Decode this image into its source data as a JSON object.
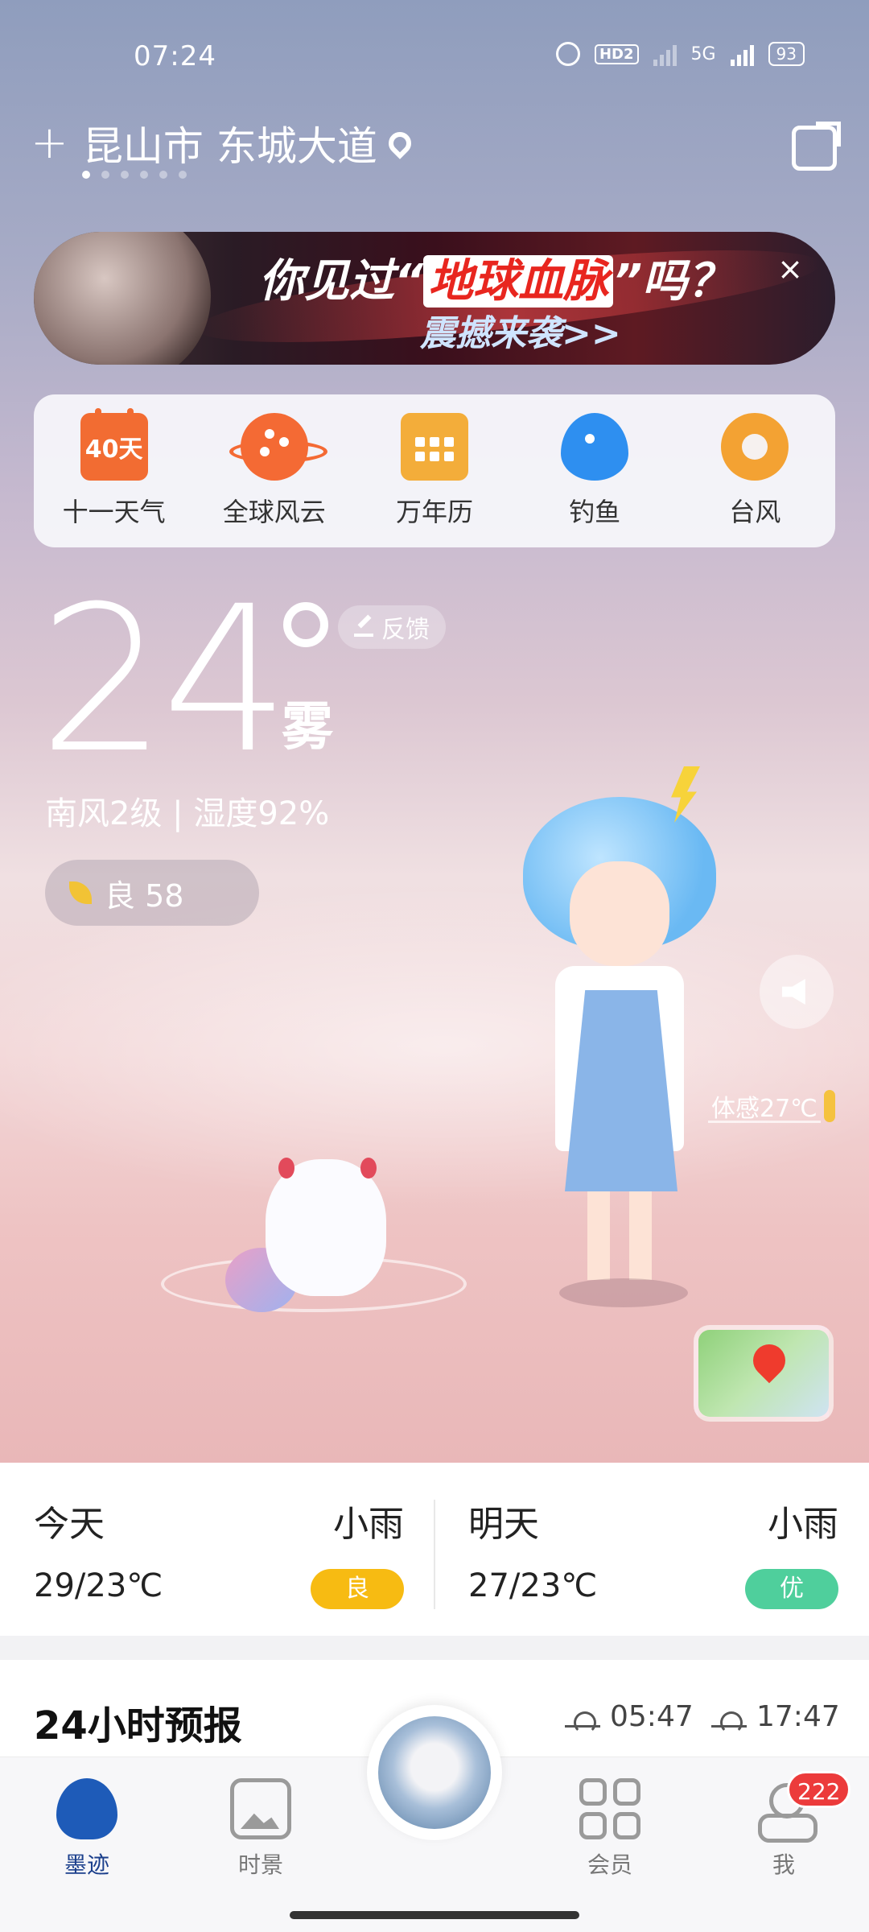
{
  "status_bar": {
    "time": "07:24",
    "hd_label": "HD2",
    "network": "5G",
    "battery": "93"
  },
  "location": {
    "add_symbol": "+",
    "name": "昆山市 东城大道"
  },
  "banner": {
    "prefix": "你见过“",
    "highlight": "地球血脉",
    "suffix": "”吗？",
    "line2": "震撼来袭>>",
    "close_symbol": "×"
  },
  "shortcuts": [
    {
      "label": "十一天气",
      "icon": "calendar-40-icon",
      "icon_text": "40天"
    },
    {
      "label": "全球风云",
      "icon": "globe-planet-icon"
    },
    {
      "label": "万年历",
      "icon": "calendar-grid-icon"
    },
    {
      "label": "钓鱼",
      "icon": "fish-icon"
    },
    {
      "label": "台风",
      "icon": "typhoon-icon"
    }
  ],
  "current": {
    "temperature": "24",
    "condition": "雾",
    "feedback": "反馈",
    "wind_humidity": "南风2级 | 湿度92%",
    "aqi": "良 58",
    "feels_like": "体感27℃"
  },
  "forecast": {
    "today": {
      "day": "今天",
      "weather": "小雨",
      "range": "29/23℃",
      "aqi": "良",
      "aqi_color": "#f7bb12"
    },
    "tomorrow": {
      "day": "明天",
      "weather": "小雨",
      "range": "27/23℃",
      "aqi": "优",
      "aqi_color": "#4fcf9c"
    }
  },
  "hourly": {
    "title": "24小时预报",
    "sunrise": "05:47",
    "sunset": "17:47"
  },
  "tabbar": {
    "tabs": [
      {
        "label": "墨迹",
        "icon": "moji-cloud-icon"
      },
      {
        "label": "时景",
        "icon": "photo-icon"
      },
      {
        "label": "会员",
        "icon": "grid-icon"
      },
      {
        "label": "我",
        "icon": "user-icon"
      }
    ],
    "badge": "222"
  },
  "colors": {
    "accent_orange": "#f26c32",
    "tab_active": "#1b3f8c",
    "badge_red": "#ec3b3b"
  }
}
